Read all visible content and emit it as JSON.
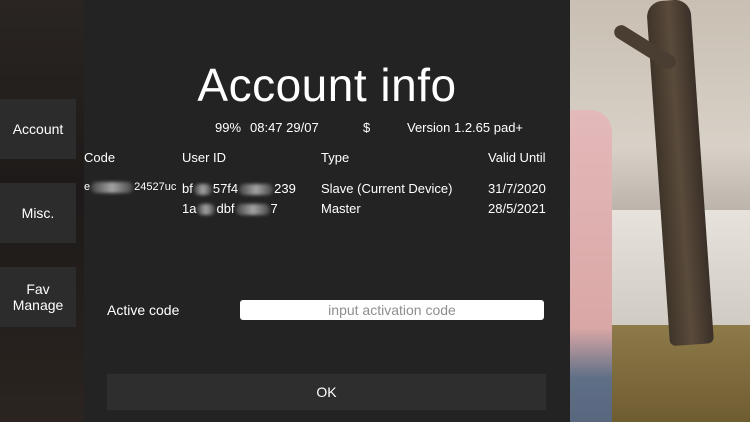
{
  "dialog": {
    "title": "Account info"
  },
  "sidebar": {
    "items": [
      {
        "label": "Account"
      },
      {
        "label": "Misc."
      },
      {
        "label": "Fav Manage"
      }
    ]
  },
  "status": {
    "battery": "99%",
    "datetime": "08:47 29/07",
    "currency": "$",
    "version": "Version 1.2.65 pad+"
  },
  "table": {
    "headers": [
      "Code",
      "User ID",
      "Type",
      "Valid Until"
    ],
    "rows": [
      {
        "code_prefix": "e",
        "code_suffix": "24527uc",
        "user_prefix": "bf",
        "user_mid": "57f4",
        "user_suffix": "239",
        "type": "Slave (Current Device)",
        "valid_until": "31/7/2020"
      },
      {
        "user_prefix": "1a",
        "user_mid": "dbf",
        "user_suffix": "7",
        "type": "Master",
        "valid_until": "28/5/2021"
      }
    ]
  },
  "activation": {
    "label": "Active code",
    "placeholder": "input activation code"
  },
  "ok_label": "OK"
}
